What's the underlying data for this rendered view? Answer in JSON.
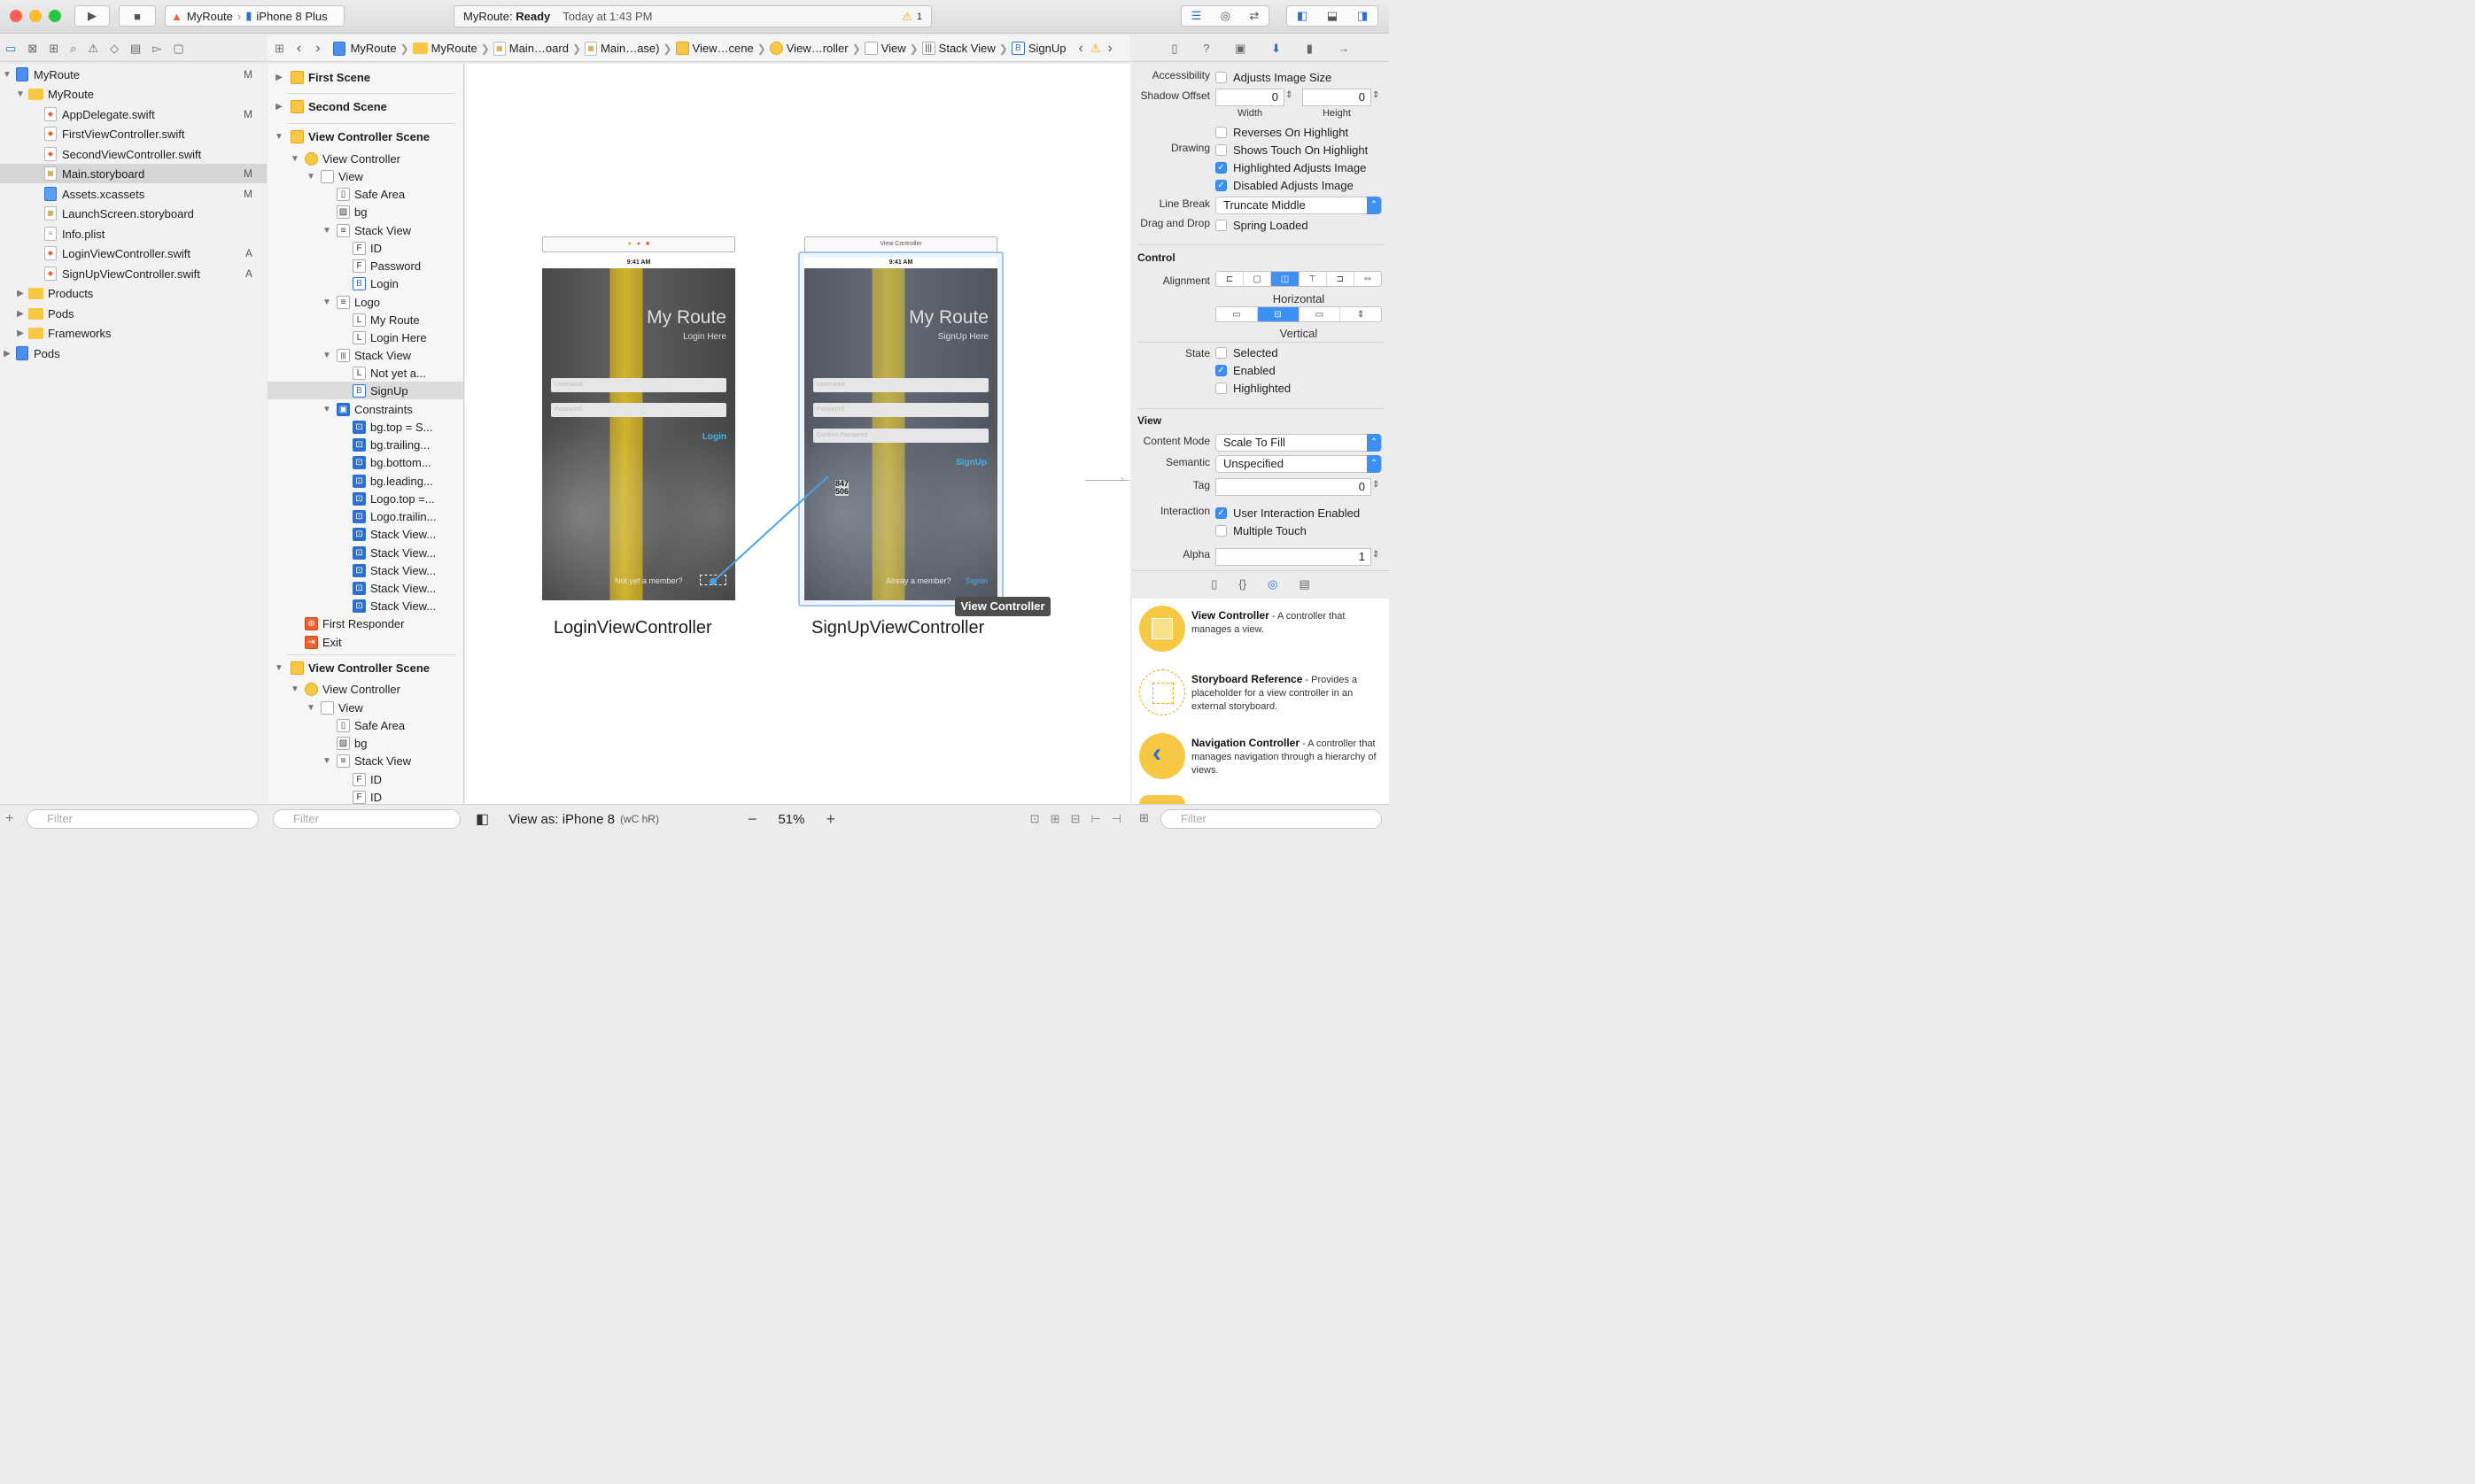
{
  "toolbar": {
    "scheme_target": "MyRoute",
    "scheme_device": "iPhone 8 Plus",
    "status_app": "MyRoute:",
    "status_state": "Ready",
    "status_time": "Today at 1:43 PM",
    "warning_count": "1"
  },
  "navigator": {
    "files": [
      {
        "label": "MyRoute",
        "badge": "M",
        "kind": "project"
      },
      {
        "label": "MyRoute",
        "badge": "",
        "kind": "folder"
      },
      {
        "label": "AppDelegate.swift",
        "badge": "M",
        "kind": "swift"
      },
      {
        "label": "FirstViewController.swift",
        "badge": "",
        "kind": "swift"
      },
      {
        "label": "SecondViewController.swift",
        "badge": "",
        "kind": "swift"
      },
      {
        "label": "Main.storyboard",
        "badge": "M",
        "kind": "storyboard"
      },
      {
        "label": "Assets.xcassets",
        "badge": "M",
        "kind": "assets"
      },
      {
        "label": "LaunchScreen.storyboard",
        "badge": "",
        "kind": "storyboard"
      },
      {
        "label": "Info.plist",
        "badge": "",
        "kind": "plist"
      },
      {
        "label": "LoginViewController.swift",
        "badge": "A",
        "kind": "swift"
      },
      {
        "label": "SignUpViewController.swift",
        "badge": "A",
        "kind": "swift"
      },
      {
        "label": "Products",
        "badge": "",
        "kind": "folder"
      },
      {
        "label": "Pods",
        "badge": "",
        "kind": "folder"
      },
      {
        "label": "Frameworks",
        "badge": "",
        "kind": "folder"
      },
      {
        "label": "Pods",
        "badge": "",
        "kind": "project"
      }
    ],
    "filter_placeholder": "Filter"
  },
  "jumpbar": [
    "MyRoute",
    "MyRoute",
    "Main…oard",
    "Main…ase)",
    "View…cene",
    "View…roller",
    "View",
    "Stack View",
    "SignUp"
  ],
  "outline": {
    "items": [
      {
        "label": "First Scene",
        "bold": true
      },
      {
        "label": "Second Scene",
        "bold": true
      },
      {
        "label": "View Controller Scene",
        "bold": true
      },
      {
        "label": "View Controller",
        "icon": "VC"
      },
      {
        "label": "View",
        "icon": ""
      },
      {
        "label": "Safe Area",
        "icon": ""
      },
      {
        "label": "bg",
        "icon": ""
      },
      {
        "label": "Stack View",
        "icon": "≡"
      },
      {
        "label": "ID",
        "icon": "F"
      },
      {
        "label": "Password",
        "icon": "F"
      },
      {
        "label": "Login",
        "icon": "B"
      },
      {
        "label": "Logo",
        "icon": "≡"
      },
      {
        "label": "My Route",
        "icon": "L"
      },
      {
        "label": "Login Here",
        "icon": "L"
      },
      {
        "label": "Stack View",
        "icon": "|||"
      },
      {
        "label": "Not yet a...",
        "icon": "L"
      },
      {
        "label": "SignUp",
        "icon": "B"
      },
      {
        "label": "Constraints",
        "icon": "C"
      },
      {
        "label": "bg.top = S...",
        "icon": "C"
      },
      {
        "label": "bg.trailing...",
        "icon": "C"
      },
      {
        "label": "bg.bottom...",
        "icon": "C"
      },
      {
        "label": "bg.leading...",
        "icon": "C"
      },
      {
        "label": "Logo.top =...",
        "icon": "C"
      },
      {
        "label": "Logo.trailin...",
        "icon": "C"
      },
      {
        "label": "Stack View...",
        "icon": "C"
      },
      {
        "label": "Stack View...",
        "icon": "C"
      },
      {
        "label": "Stack View...",
        "icon": "C"
      },
      {
        "label": "Stack View...",
        "icon": "C"
      },
      {
        "label": "Stack View...",
        "icon": "C"
      },
      {
        "label": "First Responder",
        "icon": "FR"
      },
      {
        "label": "Exit",
        "icon": "EX"
      },
      {
        "label": "View Controller Scene",
        "bold": true
      },
      {
        "label": "View Controller",
        "icon": "VC"
      },
      {
        "label": "View",
        "icon": ""
      },
      {
        "label": "Safe Area",
        "icon": ""
      },
      {
        "label": "bg",
        "icon": ""
      },
      {
        "label": "Stack View",
        "icon": "≡"
      },
      {
        "label": "ID",
        "icon": "F"
      },
      {
        "label": "ID",
        "icon": "F"
      }
    ],
    "filter_placeholder": "Filter"
  },
  "canvas": {
    "login": {
      "time": "9:41 AM",
      "title": "My Route",
      "subtitle": "Login Here",
      "username": "Username",
      "password": "Password",
      "action": "Login",
      "bottom_text": "Not yet a member?",
      "name": "LoginViewController"
    },
    "signup": {
      "header": "View Controller",
      "time": "9:41 AM",
      "title": "My Route",
      "subtitle": "SignUp Here",
      "username": "Username",
      "password": "Password",
      "confirm": "Confirm Password",
      "action": "SignUp",
      "bottom_text": "Alreay a member?",
      "bottom_link": "Signin",
      "name": "SignUpViewController",
      "coord_x": "847",
      "coord_y": "506"
    },
    "tooltip": "View Controller",
    "footer": {
      "view_as": "View as: iPhone 8",
      "size_class": "(wC hR)",
      "zoom": "51%"
    }
  },
  "inspector": {
    "accessibility_label": "Accessibility",
    "adjusts_image_size": "Adjusts Image Size",
    "shadow_offset_label": "Shadow Offset",
    "shadow_width": "0",
    "shadow_height": "0",
    "width_label": "Width",
    "height_label": "Height",
    "drawing_label": "Drawing",
    "reverses": "Reverses On Highlight",
    "shows_touch": "Shows Touch On Highlight",
    "highlighted_adjusts": "Highlighted Adjusts Image",
    "disabled_adjusts": "Disabled Adjusts Image",
    "line_break_label": "Line Break",
    "line_break_value": "Truncate Middle",
    "drag_drop_label": "Drag and Drop",
    "spring_loaded": "Spring Loaded",
    "control_header": "Control",
    "alignment_label": "Alignment",
    "horizontal": "Horizontal",
    "vertical": "Vertical",
    "state_label": "State",
    "selected": "Selected",
    "enabled": "Enabled",
    "highlighted": "Highlighted",
    "view_header": "View",
    "content_mode_label": "Content Mode",
    "content_mode_value": "Scale To Fill",
    "semantic_label": "Semantic",
    "semantic_value": "Unspecified",
    "tag_label": "Tag",
    "tag_value": "0",
    "interaction_label": "Interaction",
    "user_interaction": "User Interaction Enabled",
    "multiple_touch": "Multiple Touch",
    "alpha_label": "Alpha",
    "alpha_value": "1"
  },
  "library": [
    {
      "title": "View Controller",
      "desc": " - A controller that manages a view."
    },
    {
      "title": "Storyboard Reference",
      "desc": " - Provides a placeholder for a view controller in an external storyboard."
    },
    {
      "title": "Navigation Controller",
      "desc": " - A controller that manages navigation through a hierarchy of views."
    }
  ],
  "library_filter": "Filter",
  "colors": {
    "accent": "#3d8ff2",
    "folder": "#f7c845",
    "link": "#43b6e8"
  }
}
